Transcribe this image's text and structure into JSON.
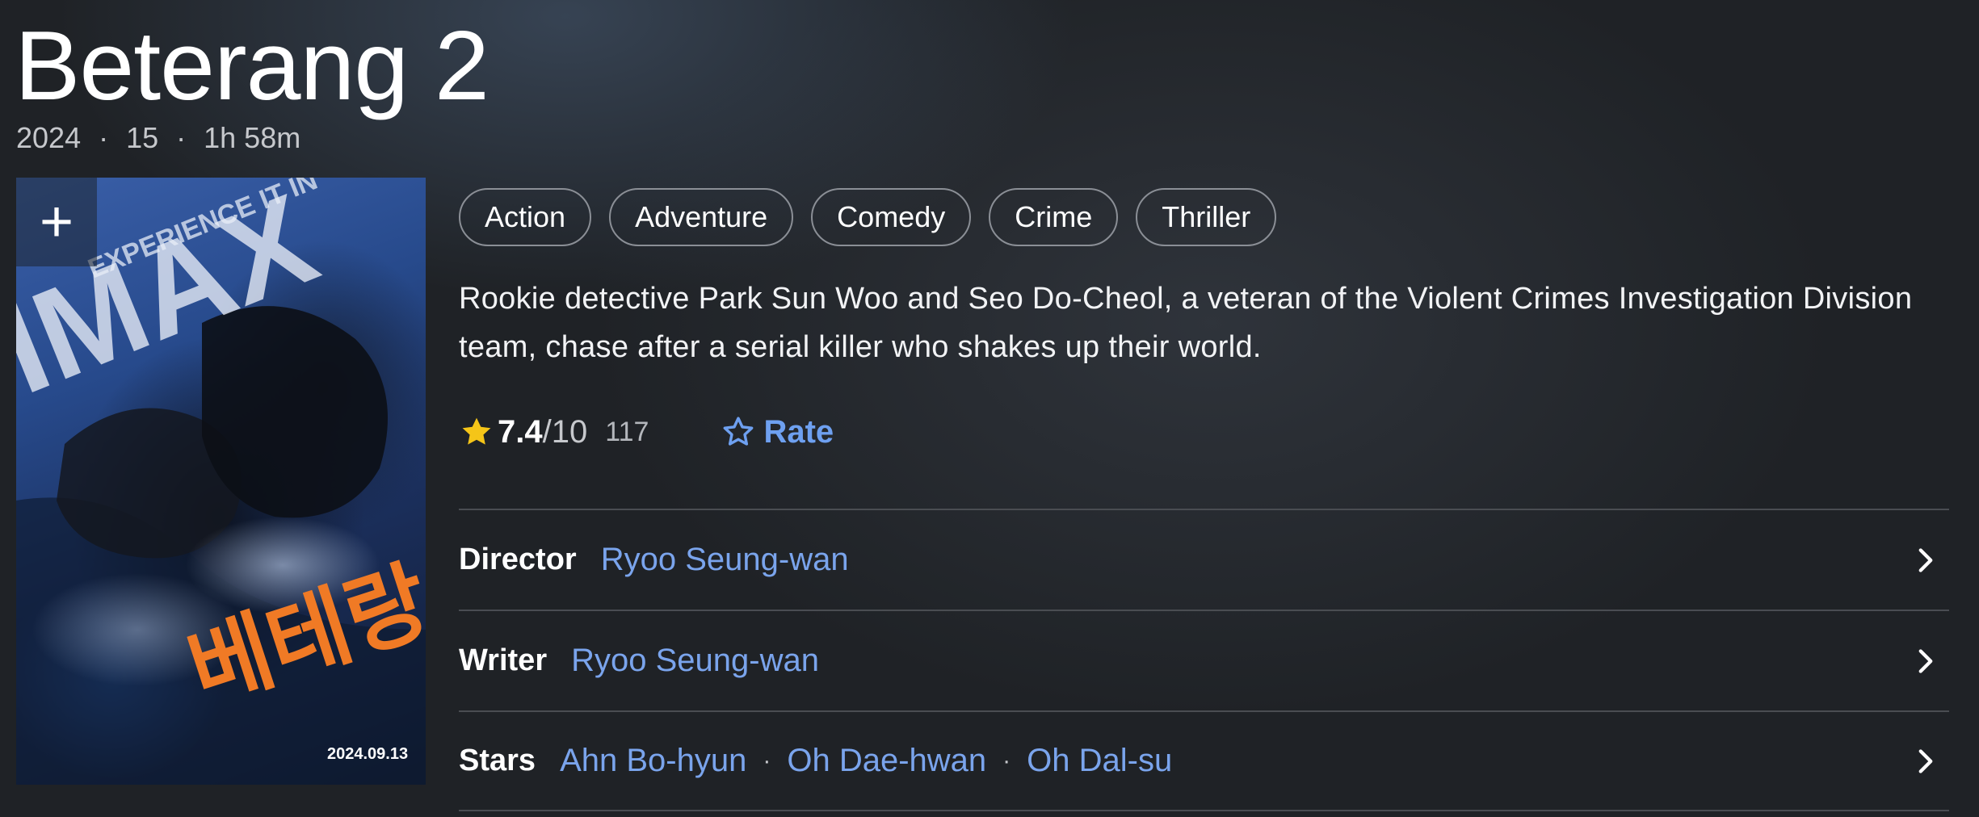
{
  "title": "Beterang 2",
  "meta": {
    "year": "2024",
    "rating": "15",
    "runtime": "1h 58m",
    "separator": "·"
  },
  "poster": {
    "add_label": "+",
    "imax_text": "IMAX",
    "experience_text": "EXPERIENCE IT IN",
    "korean_title": "베테랑",
    "date_text": "2024.09.13"
  },
  "genres": [
    "Action",
    "Adventure",
    "Comedy",
    "Crime",
    "Thriller"
  ],
  "plot": "Rookie detective Park Sun Woo and Seo Do-Cheol, a veteran of the Violent Crimes Investigation Division team, chase after a serial killer who shakes up their world.",
  "rating": {
    "score": "7.4",
    "out_of": "/10",
    "votes": "117",
    "rate_label": "Rate",
    "star_color": "#f5c518",
    "rate_color": "#6ea0f0"
  },
  "credits": {
    "director": {
      "label": "Director",
      "names": [
        "Ryoo Seung-wan"
      ]
    },
    "writer": {
      "label": "Writer",
      "names": [
        "Ryoo Seung-wan"
      ]
    },
    "stars": {
      "label": "Stars",
      "names": [
        "Ahn Bo-hyun",
        "Oh Dae-hwan",
        "Oh Dal-su"
      ],
      "separator": "·"
    }
  }
}
